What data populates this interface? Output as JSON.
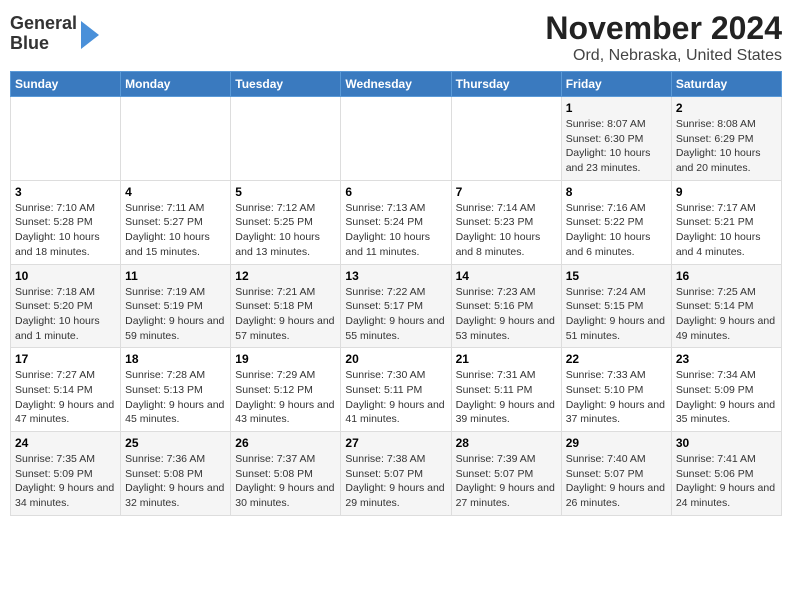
{
  "header": {
    "logo_line1": "General",
    "logo_line2": "Blue",
    "title": "November 2024",
    "subtitle": "Ord, Nebraska, United States"
  },
  "calendar": {
    "days_of_week": [
      "Sunday",
      "Monday",
      "Tuesday",
      "Wednesday",
      "Thursday",
      "Friday",
      "Saturday"
    ],
    "weeks": [
      [
        {
          "day": "",
          "info": ""
        },
        {
          "day": "",
          "info": ""
        },
        {
          "day": "",
          "info": ""
        },
        {
          "day": "",
          "info": ""
        },
        {
          "day": "",
          "info": ""
        },
        {
          "day": "1",
          "info": "Sunrise: 8:07 AM\nSunset: 6:30 PM\nDaylight: 10 hours and 23 minutes."
        },
        {
          "day": "2",
          "info": "Sunrise: 8:08 AM\nSunset: 6:29 PM\nDaylight: 10 hours and 20 minutes."
        }
      ],
      [
        {
          "day": "3",
          "info": "Sunrise: 7:10 AM\nSunset: 5:28 PM\nDaylight: 10 hours and 18 minutes."
        },
        {
          "day": "4",
          "info": "Sunrise: 7:11 AM\nSunset: 5:27 PM\nDaylight: 10 hours and 15 minutes."
        },
        {
          "day": "5",
          "info": "Sunrise: 7:12 AM\nSunset: 5:25 PM\nDaylight: 10 hours and 13 minutes."
        },
        {
          "day": "6",
          "info": "Sunrise: 7:13 AM\nSunset: 5:24 PM\nDaylight: 10 hours and 11 minutes."
        },
        {
          "day": "7",
          "info": "Sunrise: 7:14 AM\nSunset: 5:23 PM\nDaylight: 10 hours and 8 minutes."
        },
        {
          "day": "8",
          "info": "Sunrise: 7:16 AM\nSunset: 5:22 PM\nDaylight: 10 hours and 6 minutes."
        },
        {
          "day": "9",
          "info": "Sunrise: 7:17 AM\nSunset: 5:21 PM\nDaylight: 10 hours and 4 minutes."
        }
      ],
      [
        {
          "day": "10",
          "info": "Sunrise: 7:18 AM\nSunset: 5:20 PM\nDaylight: 10 hours and 1 minute."
        },
        {
          "day": "11",
          "info": "Sunrise: 7:19 AM\nSunset: 5:19 PM\nDaylight: 9 hours and 59 minutes."
        },
        {
          "day": "12",
          "info": "Sunrise: 7:21 AM\nSunset: 5:18 PM\nDaylight: 9 hours and 57 minutes."
        },
        {
          "day": "13",
          "info": "Sunrise: 7:22 AM\nSunset: 5:17 PM\nDaylight: 9 hours and 55 minutes."
        },
        {
          "day": "14",
          "info": "Sunrise: 7:23 AM\nSunset: 5:16 PM\nDaylight: 9 hours and 53 minutes."
        },
        {
          "day": "15",
          "info": "Sunrise: 7:24 AM\nSunset: 5:15 PM\nDaylight: 9 hours and 51 minutes."
        },
        {
          "day": "16",
          "info": "Sunrise: 7:25 AM\nSunset: 5:14 PM\nDaylight: 9 hours and 49 minutes."
        }
      ],
      [
        {
          "day": "17",
          "info": "Sunrise: 7:27 AM\nSunset: 5:14 PM\nDaylight: 9 hours and 47 minutes."
        },
        {
          "day": "18",
          "info": "Sunrise: 7:28 AM\nSunset: 5:13 PM\nDaylight: 9 hours and 45 minutes."
        },
        {
          "day": "19",
          "info": "Sunrise: 7:29 AM\nSunset: 5:12 PM\nDaylight: 9 hours and 43 minutes."
        },
        {
          "day": "20",
          "info": "Sunrise: 7:30 AM\nSunset: 5:11 PM\nDaylight: 9 hours and 41 minutes."
        },
        {
          "day": "21",
          "info": "Sunrise: 7:31 AM\nSunset: 5:11 PM\nDaylight: 9 hours and 39 minutes."
        },
        {
          "day": "22",
          "info": "Sunrise: 7:33 AM\nSunset: 5:10 PM\nDaylight: 9 hours and 37 minutes."
        },
        {
          "day": "23",
          "info": "Sunrise: 7:34 AM\nSunset: 5:09 PM\nDaylight: 9 hours and 35 minutes."
        }
      ],
      [
        {
          "day": "24",
          "info": "Sunrise: 7:35 AM\nSunset: 5:09 PM\nDaylight: 9 hours and 34 minutes."
        },
        {
          "day": "25",
          "info": "Sunrise: 7:36 AM\nSunset: 5:08 PM\nDaylight: 9 hours and 32 minutes."
        },
        {
          "day": "26",
          "info": "Sunrise: 7:37 AM\nSunset: 5:08 PM\nDaylight: 9 hours and 30 minutes."
        },
        {
          "day": "27",
          "info": "Sunrise: 7:38 AM\nSunset: 5:07 PM\nDaylight: 9 hours and 29 minutes."
        },
        {
          "day": "28",
          "info": "Sunrise: 7:39 AM\nSunset: 5:07 PM\nDaylight: 9 hours and 27 minutes."
        },
        {
          "day": "29",
          "info": "Sunrise: 7:40 AM\nSunset: 5:07 PM\nDaylight: 9 hours and 26 minutes."
        },
        {
          "day": "30",
          "info": "Sunrise: 7:41 AM\nSunset: 5:06 PM\nDaylight: 9 hours and 24 minutes."
        }
      ]
    ]
  }
}
